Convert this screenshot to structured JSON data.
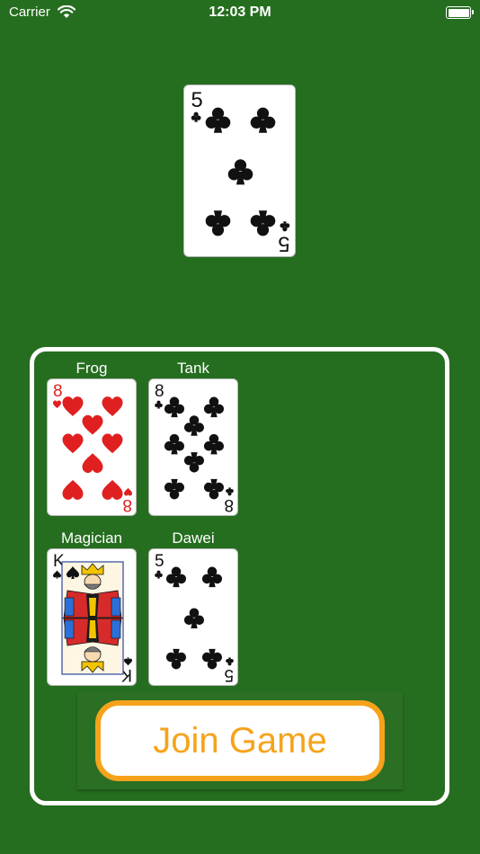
{
  "status_bar": {
    "carrier": "Carrier",
    "time": "12:03 PM"
  },
  "center_card": {
    "rank": "5",
    "suit": "clubs",
    "color": "#111111"
  },
  "players": [
    {
      "name": "Frog",
      "card": {
        "rank": "8",
        "suit": "hearts",
        "color": "#e02020"
      }
    },
    {
      "name": "Tank",
      "card": {
        "rank": "8",
        "suit": "clubs",
        "color": "#111111"
      }
    },
    {
      "name": "Magician",
      "card": {
        "rank": "K",
        "suit": "spades",
        "color": "#111111"
      }
    },
    {
      "name": "Dawei",
      "card": {
        "rank": "5",
        "suit": "clubs",
        "color": "#111111"
      }
    }
  ],
  "join_button": {
    "label": "Join Game"
  },
  "colors": {
    "table": "#256e1f",
    "accent": "#f6a31b"
  }
}
